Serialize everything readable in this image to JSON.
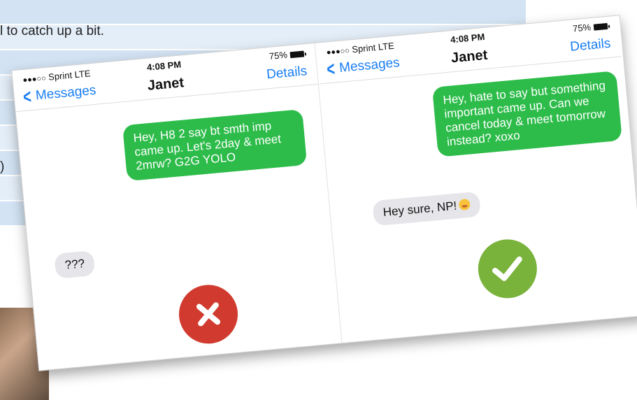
{
  "background": {
    "line1": "l to catch up a bit.",
    "paren": ")"
  },
  "left_phone": {
    "status": {
      "dots": "●●●○○",
      "carrier": "Sprint  LTE",
      "time": "4:08 PM",
      "battery": "75%"
    },
    "nav": {
      "back_label": "Messages",
      "contact": "Janet",
      "details_label": "Details"
    },
    "outgoing_message": "Hey, H8 2 say bt smth imp came up. Let's 2day & meet 2mrw? G2G YOLO",
    "incoming_message": "???",
    "result_icon": "x-icon",
    "result_color": "#d13b2f"
  },
  "right_phone": {
    "status": {
      "dots": "●●●○○",
      "carrier": "Sprint  LTE",
      "time": "4:08 PM",
      "battery": "75%"
    },
    "nav": {
      "back_label": "Messages",
      "contact": "Janet",
      "details_label": "Details"
    },
    "outgoing_message": "Hey, hate to say but something important came up. Can we cancel today & meet tomorrow instead? xoxo",
    "incoming_message": "Hey sure, NP!",
    "result_icon": "check-icon",
    "result_color": "#7ab33c"
  },
  "colors": {
    "ios_blue": "#1a7ef2",
    "sent_bubble": "#2dbc4a",
    "received_bubble": "#e6e6ea"
  }
}
